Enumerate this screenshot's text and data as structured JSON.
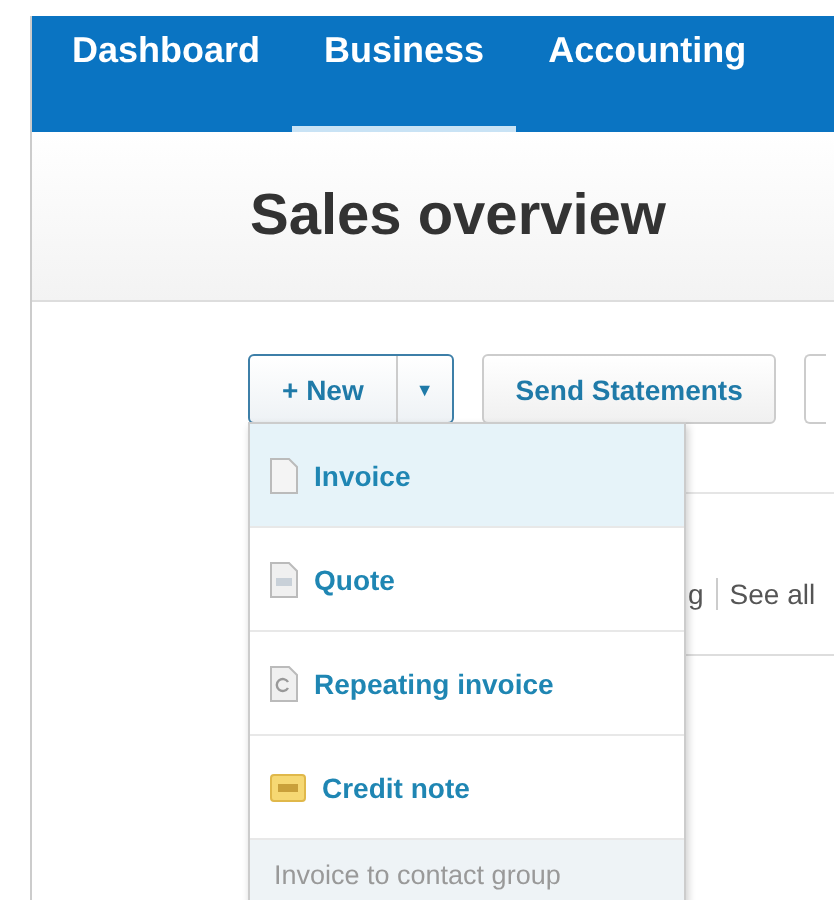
{
  "nav_tabs": [
    {
      "label": "Dashboard",
      "selected": false
    },
    {
      "label": "Business",
      "selected": true
    },
    {
      "label": "Accounting",
      "selected": false
    }
  ],
  "page_title": "Sales overview",
  "toolbar": {
    "new_button": "+ New",
    "dropdown_toggle": "▼",
    "send_statements": "Send Statements"
  },
  "background_links": {
    "partial_text": "g",
    "see_all": "See all"
  },
  "new_menu": {
    "items": [
      {
        "label": "Invoice",
        "kind": "invoice",
        "selected": true
      },
      {
        "label": "Quote",
        "kind": "quote",
        "selected": false
      },
      {
        "label": "Repeating invoice",
        "kind": "repeating",
        "selected": false
      },
      {
        "label": "Credit note",
        "kind": "credit",
        "selected": false
      }
    ],
    "footer": "Invoice to contact group"
  }
}
